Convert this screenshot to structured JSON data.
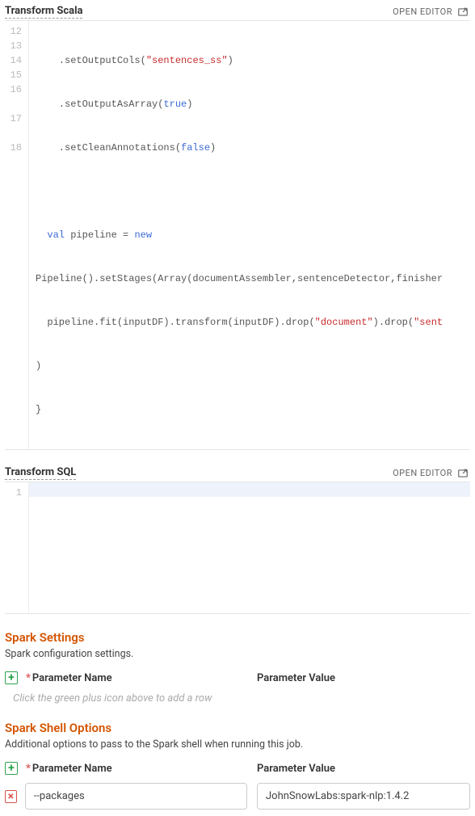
{
  "scala": {
    "title": "Transform Scala",
    "open": "OPEN EDITOR",
    "lines": [
      "12",
      "13",
      "14",
      "15",
      "16",
      "",
      "17",
      "",
      "18"
    ],
    "code12_a": "    .setOutputCols(",
    "code12_b": "\"sentences_ss\"",
    "code12_c": ")",
    "code13_a": "    .setOutputAsArray(",
    "code13_b": "true",
    "code13_c": ")",
    "code14_a": "    .setCleanAnnotations(",
    "code14_b": "false",
    "code14_c": ")",
    "code15": "",
    "code16_a": "  ",
    "code16_b": "val",
    "code16_c": " pipeline = ",
    "code16_d": "new",
    "code16w": "Pipeline().setStages(Array(documentAssembler,sentenceDetector,finisher",
    "code17_a": "  pipeline.fit(inputDF).transform(inputDF).drop(",
    "code17_b": "\"document\"",
    "code17_c": ").drop(",
    "code17_d": "\"sent",
    "code17w": ")",
    "code18": "}"
  },
  "sql": {
    "title": "Transform SQL",
    "open": "OPEN EDITOR",
    "line": "1"
  },
  "settings": {
    "heading": "Spark Settings",
    "desc": "Spark configuration settings.",
    "name_header": "Parameter Name",
    "val_header": "Parameter Value",
    "placeholder": "Click the green plus icon above to add a row"
  },
  "shell": {
    "heading": "Spark Shell Options",
    "desc": "Additional options to pass to the Spark shell when running this job.",
    "name_header": "Parameter Name",
    "val_header": "Parameter Value",
    "row": {
      "name": "--packages",
      "value": "JohnSnowLabs:spark-nlp:1.4.2"
    }
  },
  "icons": {
    "plus": "+",
    "times": "×"
  }
}
